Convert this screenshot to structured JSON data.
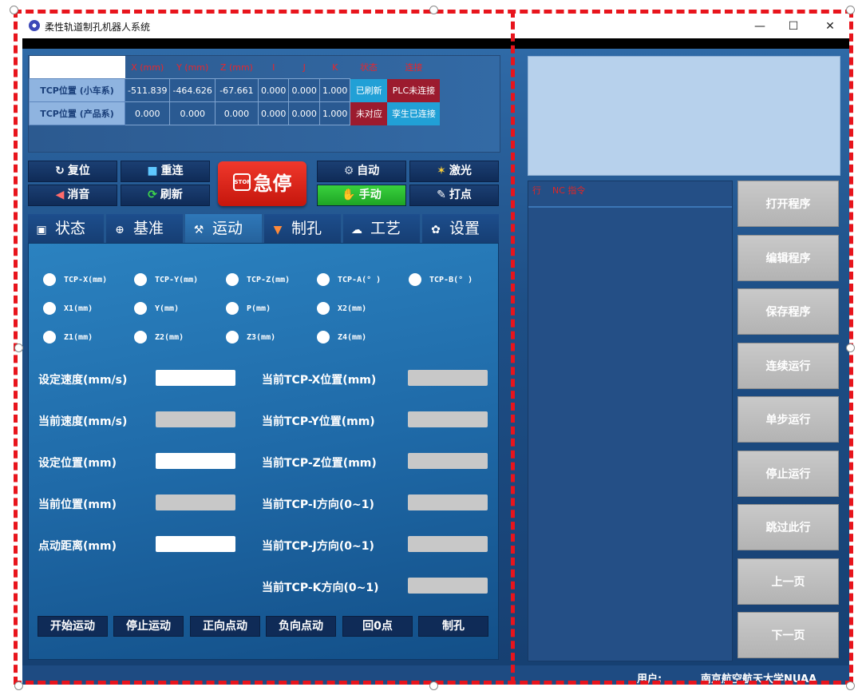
{
  "window": {
    "title": "柔性轨道制孔机器人系统",
    "minimize_glyph": "—",
    "maximize_glyph": "☐",
    "close_glyph": "✕"
  },
  "tcp_table": {
    "columns": [
      "X (mm)",
      "Y (mm)",
      "Z (mm)",
      "I",
      "J",
      "K",
      "状态",
      "连接"
    ],
    "rows": [
      {
        "label": "TCP位置 (小车系)",
        "values": [
          "-511.839",
          "-464.626",
          "-67.661",
          "0.000",
          "0.000",
          "1.000"
        ],
        "status": "已刷新",
        "connection": "PLC未连接"
      },
      {
        "label": "TCP位置 (产品系)",
        "values": [
          "0.000",
          "0.000",
          "0.000",
          "0.000",
          "0.000",
          "1.000"
        ],
        "status": "未对应",
        "connection": "孪生已连接"
      }
    ]
  },
  "control_buttons": {
    "reset": "复位",
    "reconnect": "重连",
    "mute": "消音",
    "refresh": "刷新",
    "estop": "急停",
    "estop_icon_text": "STOP",
    "auto": "自动",
    "laser": "激光",
    "manual": "手动",
    "point": "打点"
  },
  "tabs": [
    "状态",
    "基准",
    "运动",
    "制孔",
    "工艺",
    "设置"
  ],
  "motion": {
    "axes": [
      "TCP-X(mm)",
      "TCP-Y(mm)",
      "TCP-Z(mm)",
      "TCP-A(° )",
      "TCP-B(° )",
      "X1(mm)",
      "Y(mm)",
      "P(mm)",
      "X2(mm)",
      "Z1(mm)",
      "Z2(mm)",
      "Z3(mm)",
      "Z4(mm)"
    ],
    "left_fields": [
      "设定速度(mm/s)",
      "当前速度(mm/s)",
      "设定位置(mm)",
      "当前位置(mm)",
      "点动距离(mm)"
    ],
    "right_fields": [
      "当前TCP-X位置(mm)",
      "当前TCP-Y位置(mm)",
      "当前TCP-Z位置(mm)",
      "当前TCP-I方向(0~1)",
      "当前TCP-J方向(0~1)",
      "当前TCP-K方向(0~1)"
    ],
    "actions": [
      "开始运动",
      "停止运动",
      "正向点动",
      "负向点动",
      "回0点",
      "制孔"
    ]
  },
  "nc_panel": {
    "col_line": "行",
    "col_cmd": "NC 指令"
  },
  "program_buttons": [
    "打开程序",
    "编辑程序",
    "保存程序",
    "连续运行",
    "单步运行",
    "停止运行",
    "跳过此行",
    "上一页",
    "下一页"
  ],
  "status_bar": {
    "user_label": "用户:",
    "user_value": "南京航空航天大学NUAA"
  },
  "colors": {
    "accent_red": "#e8141c",
    "panel_blue": "#1e4f86",
    "estop_red": "#e0251c",
    "manual_green": "#2fbf33"
  },
  "icons": {
    "reset": "refresh-icon",
    "reconnect": "square-icon",
    "mute": "speaker-icon",
    "refresh": "cycle-icon",
    "auto": "robot-icon",
    "laser": "laser-icon",
    "manual": "hand-icon",
    "point": "pen-icon"
  }
}
